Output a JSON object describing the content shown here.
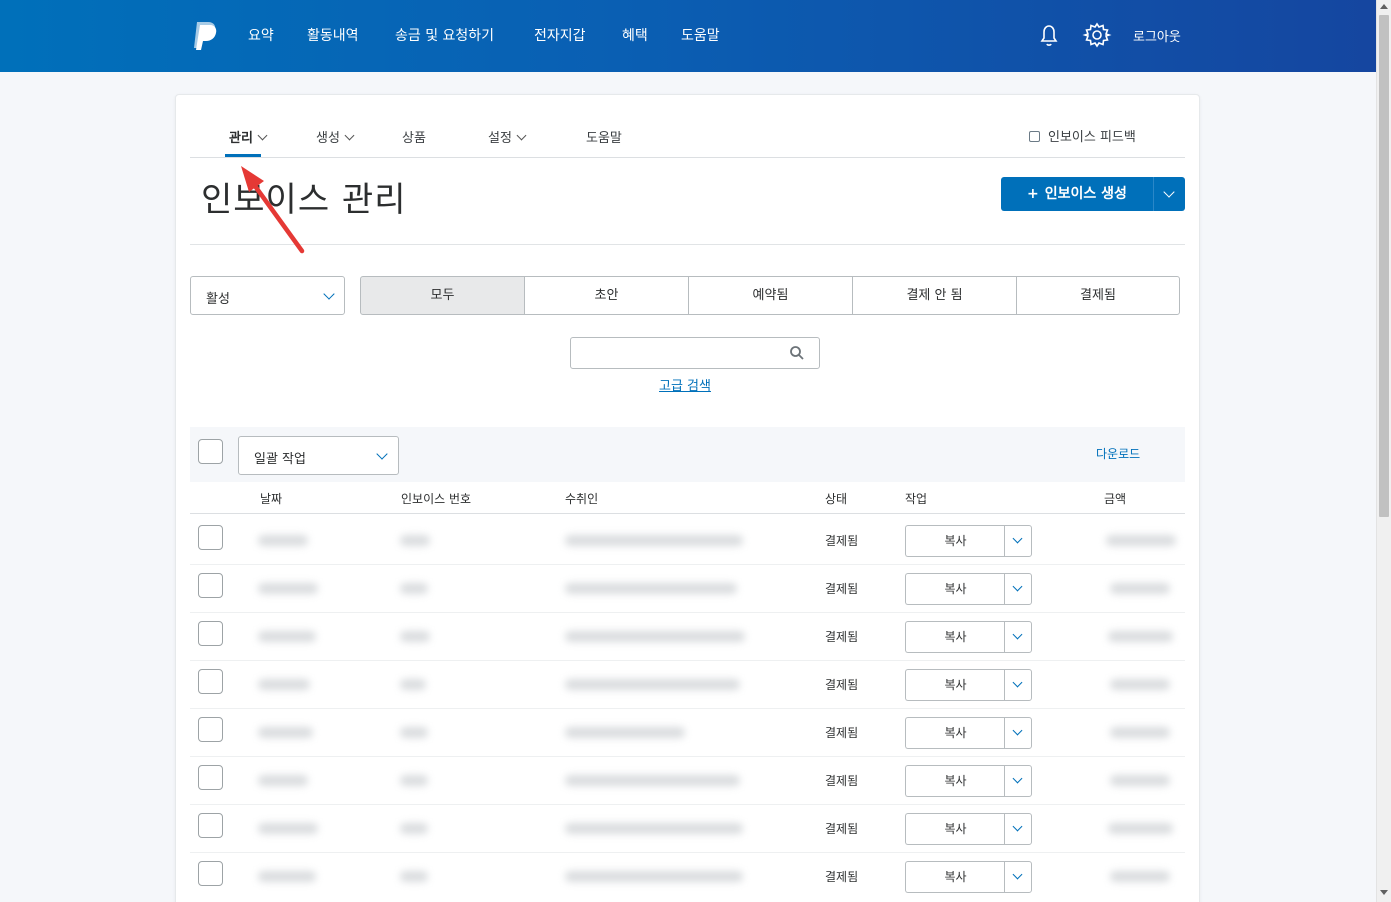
{
  "topnav": {
    "items": [
      "요약",
      "활동내역",
      "송금 및 요청하기",
      "전자지갑",
      "혜택",
      "도움말"
    ],
    "logout": "로그아웃",
    "icons": [
      "bell-icon",
      "gear-icon"
    ]
  },
  "subnav": {
    "items": [
      "관리",
      "생성",
      "상품",
      "설정",
      "도움말"
    ],
    "active": "관리",
    "feedback": "인보이스 피드백"
  },
  "page": {
    "title": "인보이스 관리",
    "create_button": "인보이스 생성"
  },
  "filters": {
    "status_select": "활성",
    "segments": [
      "모두",
      "초안",
      "예약됨",
      "결제 안 됨",
      "결제됨"
    ],
    "active_segment": "모두",
    "search_placeholder": "",
    "advanced_search": "고급 검색"
  },
  "table": {
    "bulk_action": "일괄 작업",
    "download": "다운로드",
    "headers": [
      "날짜",
      "인보이스 번호",
      "수취인",
      "상태",
      "작업",
      "금액"
    ],
    "rows": [
      {
        "status": "결제됨",
        "action": "복사"
      },
      {
        "status": "결제됨",
        "action": "복사"
      },
      {
        "status": "결제됨",
        "action": "복사"
      },
      {
        "status": "결제됨",
        "action": "복사"
      },
      {
        "status": "결제됨",
        "action": "복사"
      },
      {
        "status": "결제됨",
        "action": "복사"
      },
      {
        "status": "결제됨",
        "action": "복사"
      },
      {
        "status": "결제됨",
        "action": "복사"
      }
    ]
  },
  "colors": {
    "brand_blue": "#0070ba",
    "nav_gradient_end": "#1546a0",
    "annotation_arrow": "#e53935"
  }
}
